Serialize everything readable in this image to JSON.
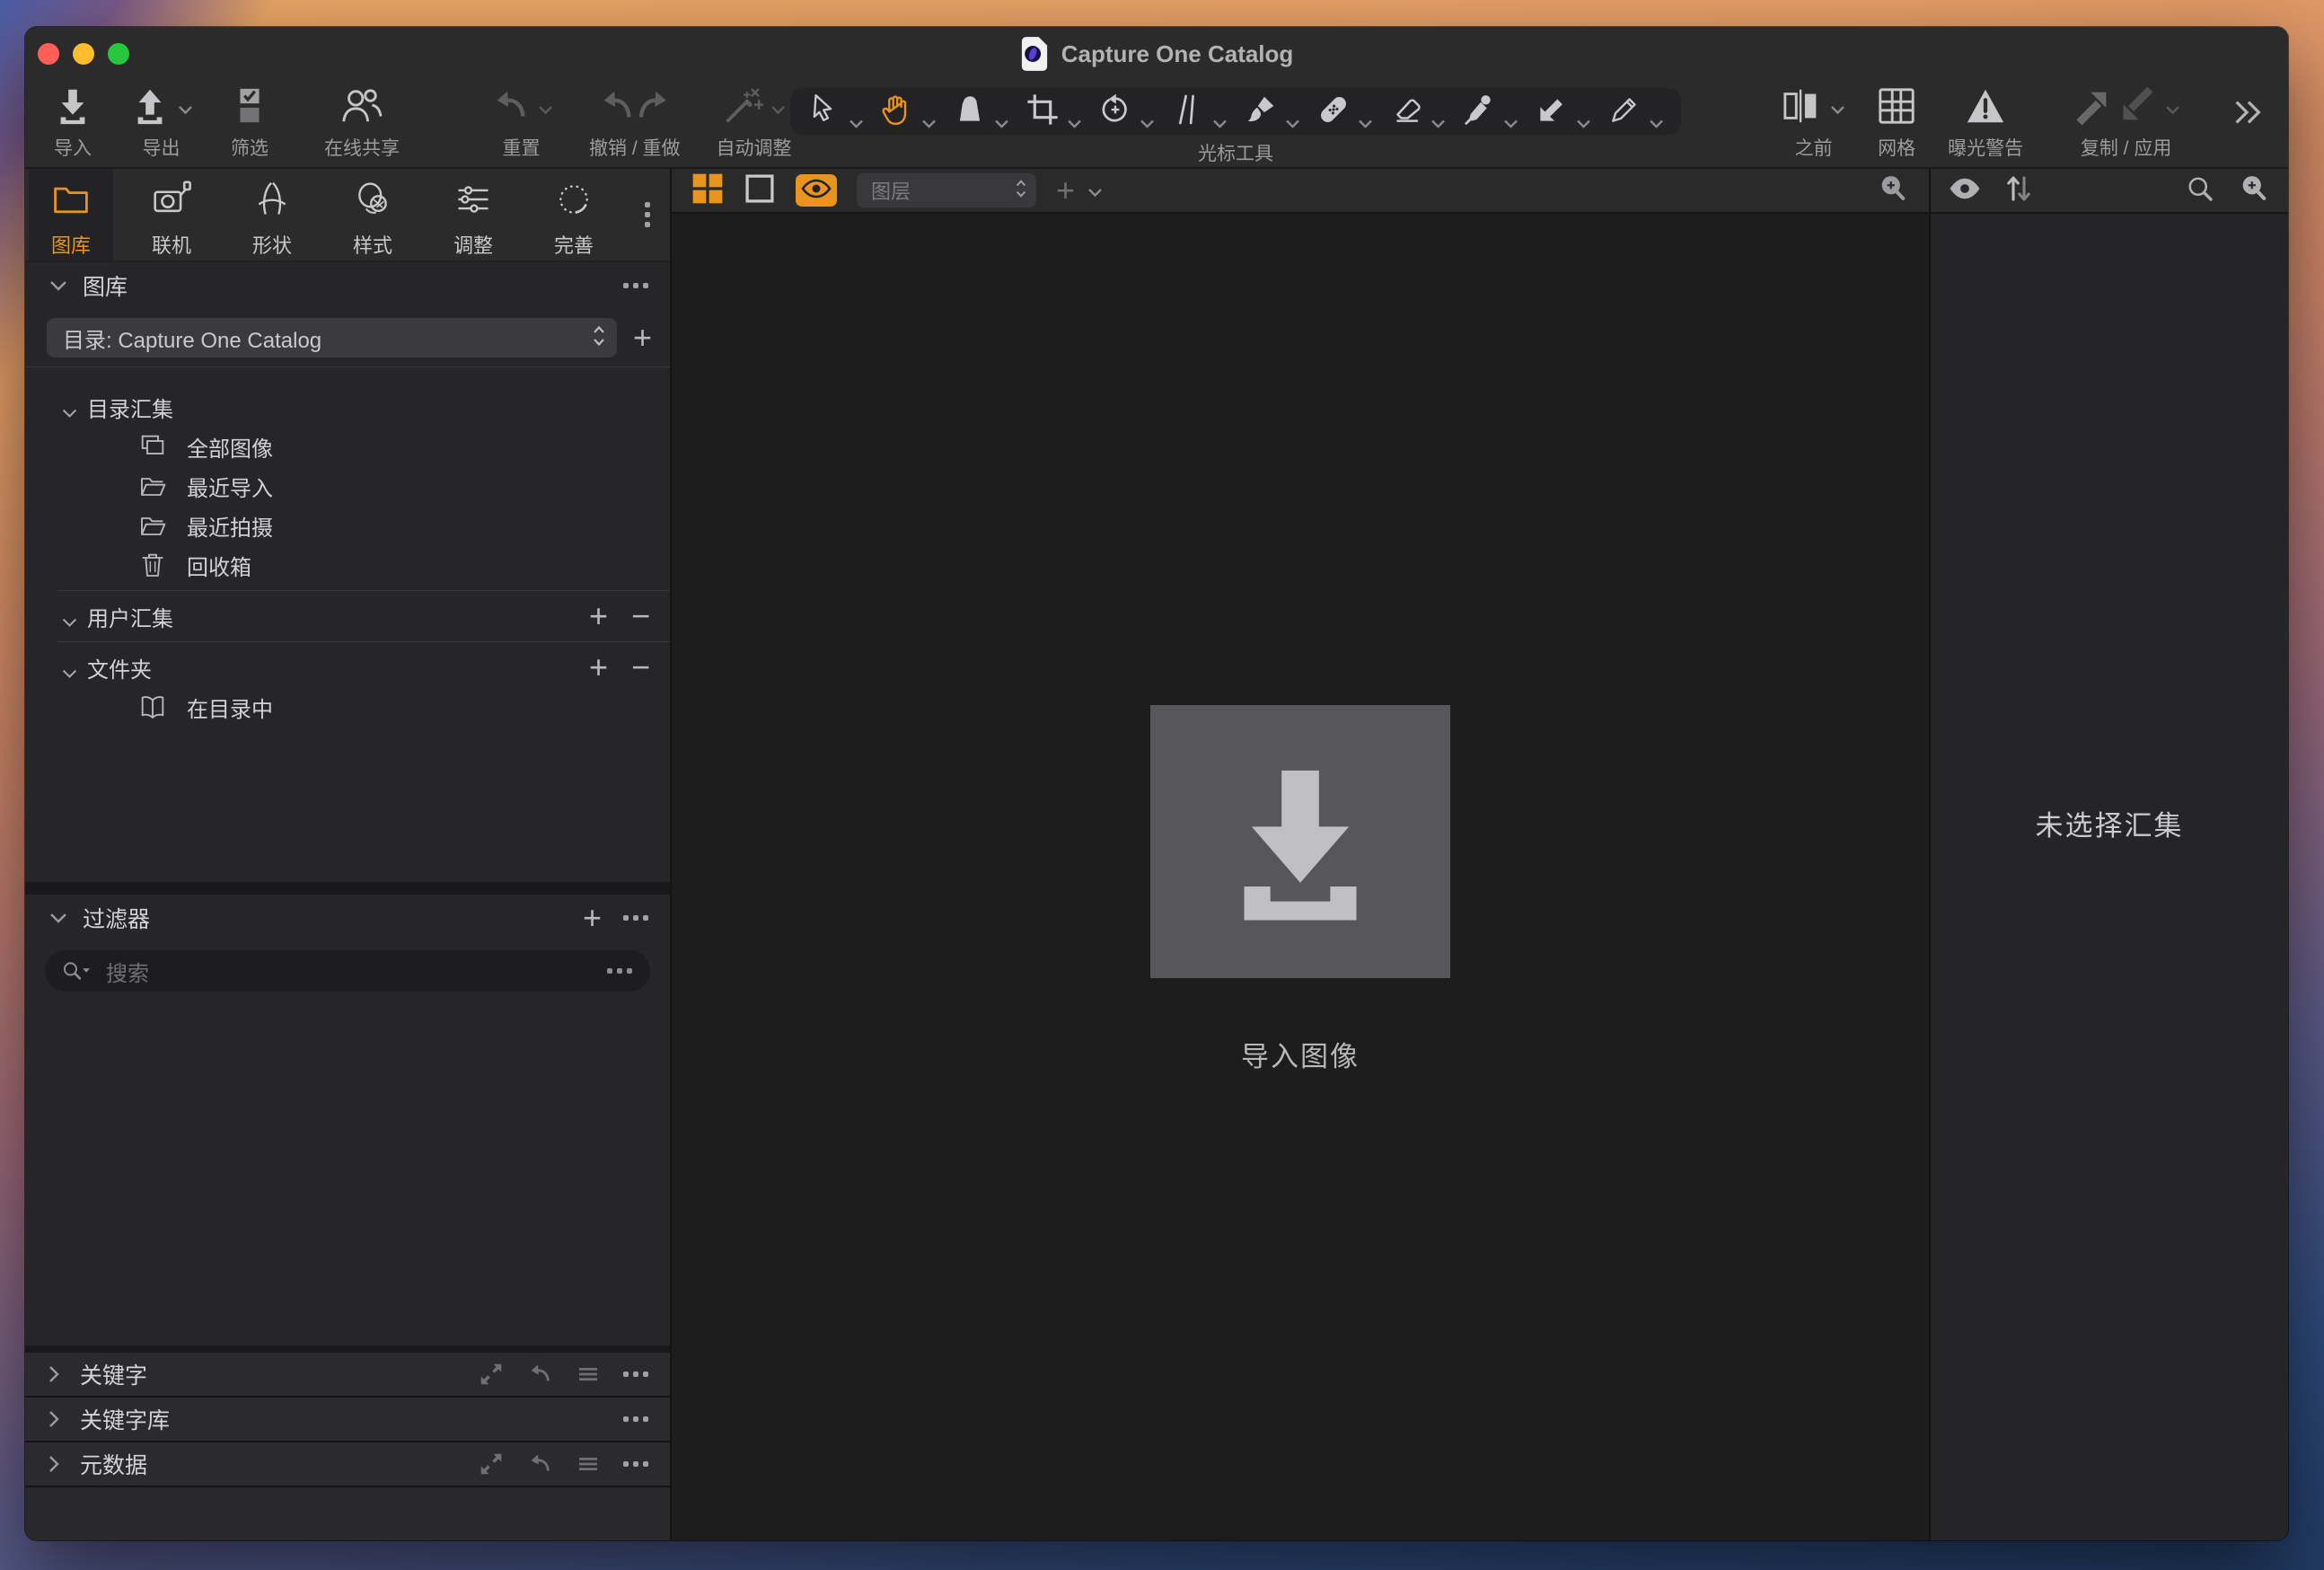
{
  "window": {
    "title": "Capture One Catalog"
  },
  "glyphs": {
    "plus": "+",
    "minus": "−"
  },
  "colors": {
    "accent": "#e8941f",
    "chrome": "#2b2b2c",
    "panel": "#262628",
    "viewer_bg": "#1d1d1e",
    "traffic_red": "#ff5f57",
    "traffic_yellow": "#febc2e",
    "traffic_green": "#29c73f"
  },
  "toolbar": {
    "left": [
      {
        "icon": "import-icon",
        "label": "导入",
        "enabled": true,
        "dropdown": false
      },
      {
        "icon": "export-icon",
        "label": "导出",
        "enabled": true,
        "dropdown": true
      },
      {
        "icon": "cull-icon",
        "label": "筛选",
        "enabled": true,
        "dropdown": false
      },
      {
        "icon": "online-share-icon",
        "label": "在线共享",
        "enabled": true,
        "dropdown": false
      },
      {
        "icon": "reset-icon",
        "label": "重置",
        "enabled": false,
        "dropdown": true
      },
      {
        "icon": "undo-redo-icon",
        "label": "撤销 / 重做",
        "enabled": false,
        "dropdown": false
      },
      {
        "icon": "auto-adjust-icon",
        "label": "自动调整",
        "enabled": false,
        "dropdown": true
      }
    ],
    "cursor_tools_label": "光标工具",
    "cursor_tools": [
      {
        "icon": "pointer-tool-icon",
        "active": false
      },
      {
        "icon": "hand-tool-icon",
        "active": true
      },
      {
        "icon": "loupe-tool-icon",
        "active": false
      },
      {
        "icon": "crop-tool-icon",
        "active": false
      },
      {
        "icon": "rotate-tool-icon",
        "active": false
      },
      {
        "icon": "straighten-tool-icon",
        "active": false
      },
      {
        "icon": "brush-tool-icon",
        "active": false
      },
      {
        "icon": "heal-tool-icon",
        "active": false
      },
      {
        "icon": "eraser-tool-icon",
        "active": false
      },
      {
        "icon": "dropper-tool-icon",
        "active": false
      },
      {
        "icon": "apply-arrow-tool-icon",
        "active": false
      },
      {
        "icon": "pen-tool-icon",
        "active": false
      }
    ],
    "right": [
      {
        "icon": "before-after-icon",
        "label": "之前",
        "enabled": true,
        "dropdown": true
      },
      {
        "icon": "grid-icon",
        "label": "网格",
        "enabled": true,
        "dropdown": false
      },
      {
        "icon": "exposure-warning-icon",
        "label": "曝光警告",
        "enabled": true,
        "dropdown": false
      },
      {
        "icon": "copy-apply-icon",
        "label": "复制 / 应用",
        "enabled": false,
        "dropdown": true
      }
    ],
    "overflow_icon": "chevron-double-right-icon"
  },
  "sidebar": {
    "tabs": [
      {
        "icon": "library-tab-icon",
        "label": "图库",
        "active": true
      },
      {
        "icon": "capture-tab-icon",
        "label": "联机",
        "active": false
      },
      {
        "icon": "shapes-tab-icon",
        "label": "形状",
        "active": false
      },
      {
        "icon": "styles-tab-icon",
        "label": "样式",
        "active": false
      },
      {
        "icon": "adjustments-tab-icon",
        "label": "调整",
        "active": false
      },
      {
        "icon": "refine-tab-icon",
        "label": "完善",
        "active": false
      }
    ],
    "library": {
      "title": "图库",
      "catalog_select": {
        "value": "目录: Capture One Catalog"
      },
      "sections": [
        {
          "title": "目录汇集",
          "items": [
            {
              "icon": "all-images-icon",
              "label": "全部图像"
            },
            {
              "icon": "recent-imports-icon",
              "label": "最近导入"
            },
            {
              "icon": "recent-captures-icon",
              "label": "最近拍摄"
            },
            {
              "icon": "trash-icon",
              "label": "回收箱"
            }
          ]
        },
        {
          "title": "用户汇集",
          "items": []
        },
        {
          "title": "文件夹",
          "items": [
            {
              "icon": "in-catalog-icon",
              "label": "在目录中"
            }
          ]
        }
      ]
    },
    "filters": {
      "title": "过滤器",
      "search_placeholder": "搜索"
    },
    "panels": [
      {
        "title": "关键字"
      },
      {
        "title": "关键字库"
      },
      {
        "title": "元数据"
      }
    ]
  },
  "viewer": {
    "layers_select": {
      "value": "图层"
    },
    "empty_state_label": "导入图像"
  },
  "browser": {
    "empty_state_label": "未选择汇集"
  }
}
